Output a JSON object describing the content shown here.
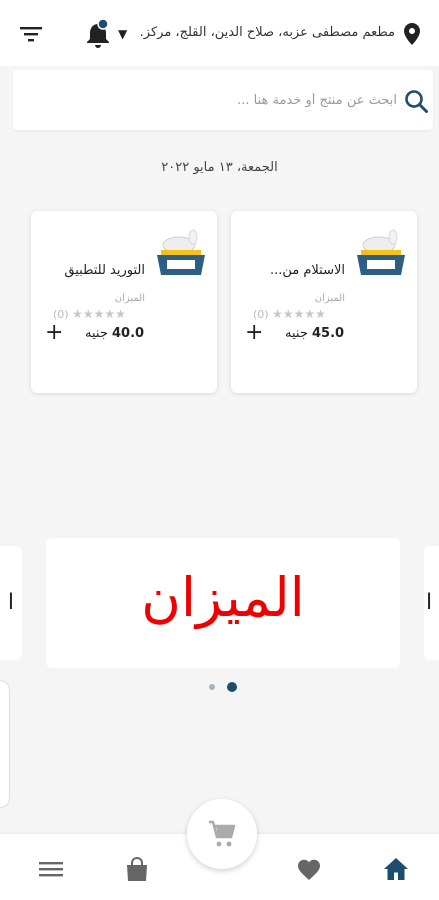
{
  "header": {
    "location": "مطعم مصطفى عزبه، صلاح الدين، القلج، مركز...",
    "icons": [
      "filter-icon",
      "bell-icon",
      "chevron-down-icon",
      "location-pin-icon"
    ],
    "notification_dot_color": "#1d4d6e"
  },
  "search": {
    "placeholder": "ابحث عن منتج أو خدمة هنا ...",
    "icon": "search-icon"
  },
  "date": "الجمعة، ١٣ مايو ٢٠٢٢",
  "products": [
    {
      "name": "الاستلام من...",
      "brand": "الميزان",
      "rating_count": "(0)",
      "price_value": "45.0",
      "currency": "جنيه"
    },
    {
      "name": "التوريد للتطبيق",
      "brand": "الميزان",
      "rating_count": "(0)",
      "price_value": "40.0",
      "currency": "جنيه"
    }
  ],
  "banner": {
    "text": "الميزان",
    "text_color": "#e00000",
    "left_peek_text": "ا",
    "right_peek_text": "ا",
    "active_dot_color": "#1d4d6e",
    "inactive_dot_color": "#9fb3c2"
  },
  "bottom_nav": {
    "items": [
      "menu-icon",
      "bag-icon",
      "cart-icon",
      "heart-icon",
      "home-icon"
    ],
    "active": "home-icon",
    "active_color": "#1d4d6e",
    "inactive_color": "#666666"
  }
}
